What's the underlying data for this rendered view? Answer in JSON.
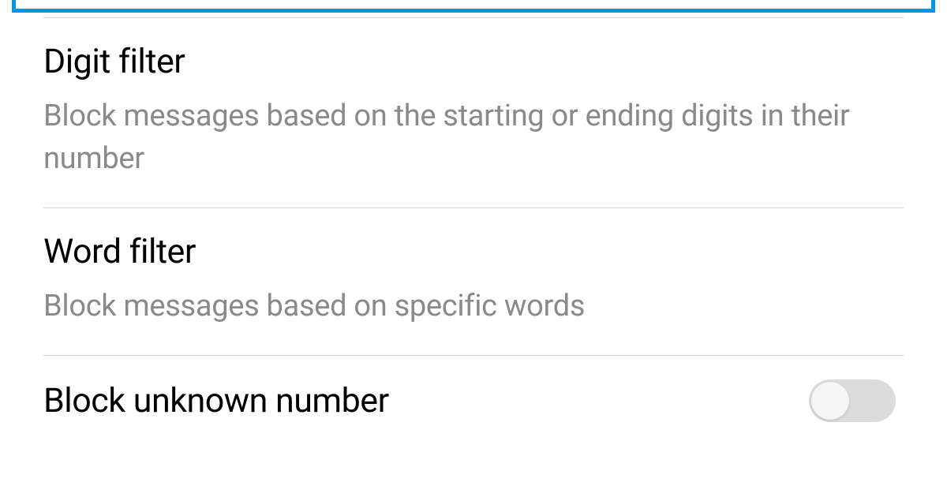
{
  "settings": {
    "digitFilter": {
      "title": "Digit filter",
      "description": "Block messages based on the starting or ending digits in their number"
    },
    "wordFilter": {
      "title": "Word filter",
      "description": "Block messages based on specific words"
    },
    "blockUnknown": {
      "title": "Block unknown number",
      "enabled": false
    }
  }
}
